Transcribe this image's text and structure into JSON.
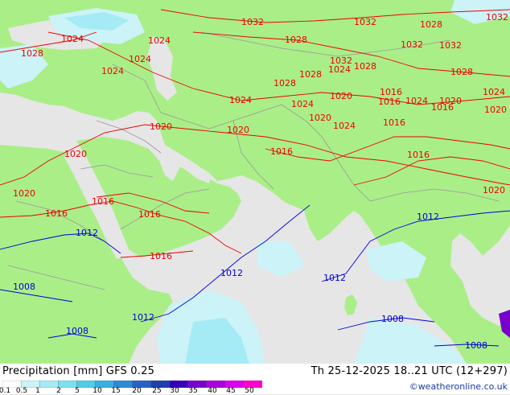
{
  "header": {
    "title_left": "Precipitation [mm]  GFS 0.25",
    "title_right": "Th 25-12-2025 18..21 UTC (12+297)",
    "credit": "©weatheronline.co.uk"
  },
  "colors": {
    "land": "#aaee88",
    "sea": "#e6e6e6",
    "border": "#999999",
    "isobar_high": "#ee0000",
    "isobar_low": "#0000dd"
  },
  "legend": {
    "ticks": [
      "0.1",
      "0.5",
      "1",
      "2",
      "5",
      "10",
      "15",
      "20",
      "25",
      "30",
      "35",
      "40",
      "45",
      "50"
    ],
    "colors": [
      "#ffffff",
      "#cbf3f8",
      "#a5ebf5",
      "#7fdff0",
      "#53cbe9",
      "#3aaee0",
      "#2d8bd4",
      "#2563c3",
      "#1e3fae",
      "#3300bb",
      "#7700cc",
      "#aa00dd",
      "#dd00ee",
      "#ff00cc"
    ]
  },
  "isobars": [
    {
      "label": "1032"
    },
    {
      "label": "1032"
    },
    {
      "label": "1032"
    },
    {
      "label": "1028"
    },
    {
      "label": "1028"
    },
    {
      "label": "1028"
    },
    {
      "label": "1028"
    },
    {
      "label": "1028"
    },
    {
      "label": "1028"
    },
    {
      "label": "1032"
    },
    {
      "label": "1032"
    },
    {
      "label": "1032"
    },
    {
      "label": "1028"
    },
    {
      "label": "1024"
    },
    {
      "label": "1024"
    },
    {
      "label": "1024"
    },
    {
      "label": "1024"
    },
    {
      "label": "1024"
    },
    {
      "label": "1024"
    },
    {
      "label": "1024"
    },
    {
      "label": "1024"
    },
    {
      "label": "1024"
    },
    {
      "label": "1024"
    },
    {
      "label": "1020"
    },
    {
      "label": "1020"
    },
    {
      "label": "1020"
    },
    {
      "label": "1020"
    },
    {
      "label": "1020"
    },
    {
      "label": "1020"
    },
    {
      "label": "1020"
    },
    {
      "label": "1020"
    },
    {
      "label": "1020"
    },
    {
      "label": "1016"
    },
    {
      "label": "1016"
    },
    {
      "label": "1016"
    },
    {
      "label": "1016"
    },
    {
      "label": "1016"
    },
    {
      "label": "1016"
    },
    {
      "label": "1016"
    },
    {
      "label": "1016"
    },
    {
      "label": "1016"
    },
    {
      "label": "1016"
    },
    {
      "label": "1012"
    },
    {
      "label": "1012"
    },
    {
      "label": "1012"
    },
    {
      "label": "1012"
    },
    {
      "label": "1012"
    },
    {
      "label": "1008"
    },
    {
      "label": "1008"
    },
    {
      "label": "1008"
    },
    {
      "label": "1008"
    }
  ]
}
